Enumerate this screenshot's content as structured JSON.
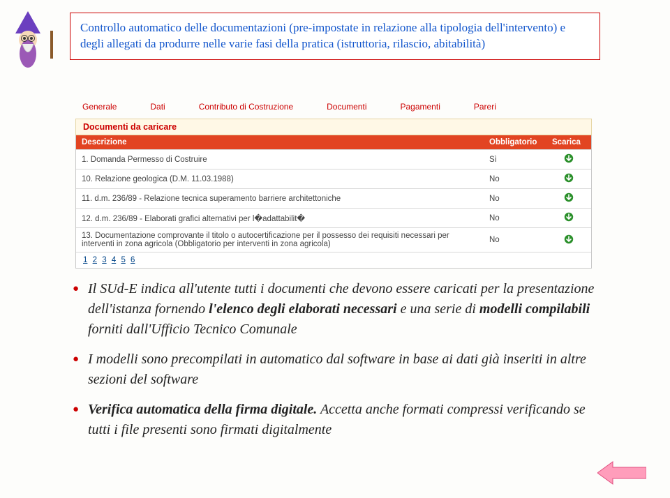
{
  "callout": {
    "text": "Controllo automatico delle documentazioni (pre-impostate in relazione alla tipologia dell'intervento) e degli allegati da produrre nelle varie fasi della pratica (istruttoria, rilascio, abitabilità)"
  },
  "app": {
    "tabs": [
      "Generale",
      "Dati",
      "Contributo di Costruzione",
      "Documenti",
      "Pagamenti",
      "Pareri"
    ],
    "subhead": "Documenti da caricare",
    "columns": {
      "descrizione": "Descrizione",
      "obbligatorio": "Obbligatorio",
      "scarica": "Scarica"
    },
    "rows": [
      {
        "desc": "1. Domanda Permesso di Costruire",
        "obbl": "Sì"
      },
      {
        "desc": "10. Relazione geologica (D.M. 11.03.1988)",
        "obbl": "No"
      },
      {
        "desc": "11. d.m. 236/89 - Relazione tecnica superamento barriere architettoniche",
        "obbl": "No"
      },
      {
        "desc": "12. d.m. 236/89 - Elaborati grafici alternativi per l�adattabilit�",
        "obbl": "No"
      },
      {
        "desc": "13. Documentazione comprovante il titolo o autocertificazione per il possesso dei requisiti necessari per interventi in zona agricola (Obbligatorio per interventi in zona agricola)",
        "obbl": "No"
      }
    ],
    "pager": [
      "1",
      "2",
      "3",
      "4",
      "5",
      "6"
    ]
  },
  "bullets": {
    "b1_a": "Il SUd-E indica all'utente tutti i documenti che devono essere caricati per la presentazione dell'istanza fornendo ",
    "b1_b": "l'elenco degli elaborati necessari",
    "b1_c": " e una serie di ",
    "b1_d": "modelli compilabili",
    "b1_e": " forniti dall'Ufficio Tecnico Comunale",
    "b2": "I modelli sono precompilati in automatico dal software in base ai dati già inseriti in altre sezioni del software",
    "b3_a": "Verifica automatica della firma digitale.",
    "b3_b": " Accetta anche formati compressi verificando se tutti i file presenti sono firmati digitalmente"
  }
}
